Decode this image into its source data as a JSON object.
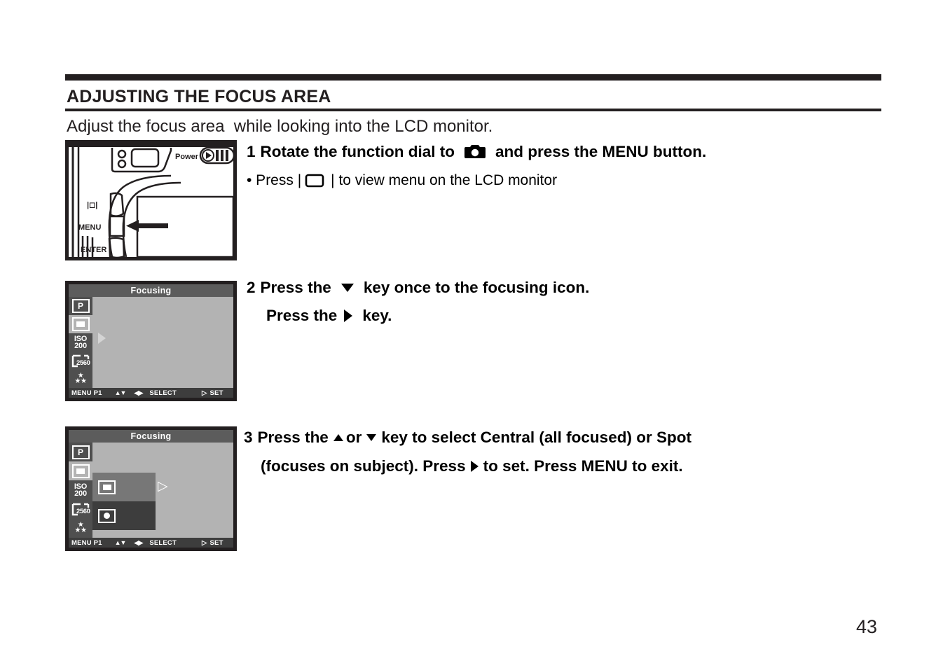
{
  "document": {
    "section_title": "ADJUSTING THE FOCUS AREA",
    "intro": "Adjust the focus area  while looking into the LCD monitor.",
    "page_number": "43"
  },
  "steps": {
    "step1": {
      "number": "1",
      "text_before_icon": "Rotate the function dial to",
      "icon": "camera-icon",
      "text_after_icon": "and press the MENU button.",
      "bullet_before": "• Press |",
      "bullet_icon": "lcd-monitor-icon",
      "bullet_after": "| to view menu on the LCD monitor"
    },
    "step2": {
      "number": "2",
      "line1_before": "Press the",
      "line1_icon": "down-arrow-icon",
      "line1_after": "key once to the focusing icon.",
      "line2_before": "Press the",
      "line2_icon": "right-arrow-icon",
      "line2_after": "key."
    },
    "step3": {
      "number": "3",
      "line1_a": "Press the",
      "line1_icon1": "up-arrow-icon",
      "line1_b": "or",
      "line1_icon2": "down-arrow-icon",
      "line1_c": "key to select Central (all focused) or Spot",
      "line2_a": "(focuses on subject). Press",
      "line2_icon": "right-arrow-icon",
      "line2_b": "to set.  Press MENU to exit."
    }
  },
  "camera_figure": {
    "alt": "Rear of camera showing MENU button with arrow pointing at it",
    "labels": {
      "power": "Power",
      "display": "|□|",
      "menu": "MENU",
      "enter": "ENTER"
    }
  },
  "lcd_screens": [
    {
      "id": "lcd-focusing-collapsed",
      "title": "Focusing",
      "sidebar_icons": [
        {
          "name": "program-mode-icon",
          "label": "P",
          "active": false
        },
        {
          "name": "focusing-area-icon",
          "label": "",
          "active": true
        },
        {
          "name": "iso-icon",
          "label": "ISO 200",
          "iso_top": "ISO",
          "iso_bottom": "200",
          "active": false
        },
        {
          "name": "resolution-icon",
          "label": "2560",
          "active": false
        },
        {
          "name": "quality-stars-icon",
          "label": "★★★",
          "active": false
        }
      ],
      "submenu": [],
      "footer": {
        "menu": "MENU P1",
        "updown": "▲▼",
        "leftright": "◀▶",
        "select": "SELECT",
        "set_arrow": "▷",
        "set": "SET"
      }
    },
    {
      "id": "lcd-focusing-expanded",
      "title": "Focusing",
      "sidebar_icons": [
        {
          "name": "program-mode-icon",
          "label": "P",
          "active": false
        },
        {
          "name": "focusing-area-icon",
          "label": "",
          "active": true
        },
        {
          "name": "iso-icon",
          "label": "ISO 200",
          "iso_top": "ISO",
          "iso_bottom": "200",
          "active": false
        },
        {
          "name": "resolution-icon",
          "label": "2560",
          "active": false
        },
        {
          "name": "quality-stars-icon",
          "label": "★★★",
          "active": false
        }
      ],
      "submenu": [
        {
          "name": "central-focus-option",
          "icon": "central-focus-icon",
          "highlighted": true
        },
        {
          "name": "spot-focus-option",
          "icon": "spot-focus-icon",
          "highlighted": false
        }
      ],
      "footer": {
        "menu": "MENU P1",
        "updown": "▲▼",
        "leftright": "◀▶",
        "select": "SELECT",
        "set_arrow": "▷",
        "set": "SET"
      }
    }
  ],
  "colors": {
    "ink": "#231f20",
    "lcd_background": "#b3b3b3",
    "lcd_titlebar": "#5c5c5c",
    "lcd_sidebar": "#4f4f4f",
    "lcd_footer": "#3d3d3d",
    "highlight": "#777777"
  }
}
